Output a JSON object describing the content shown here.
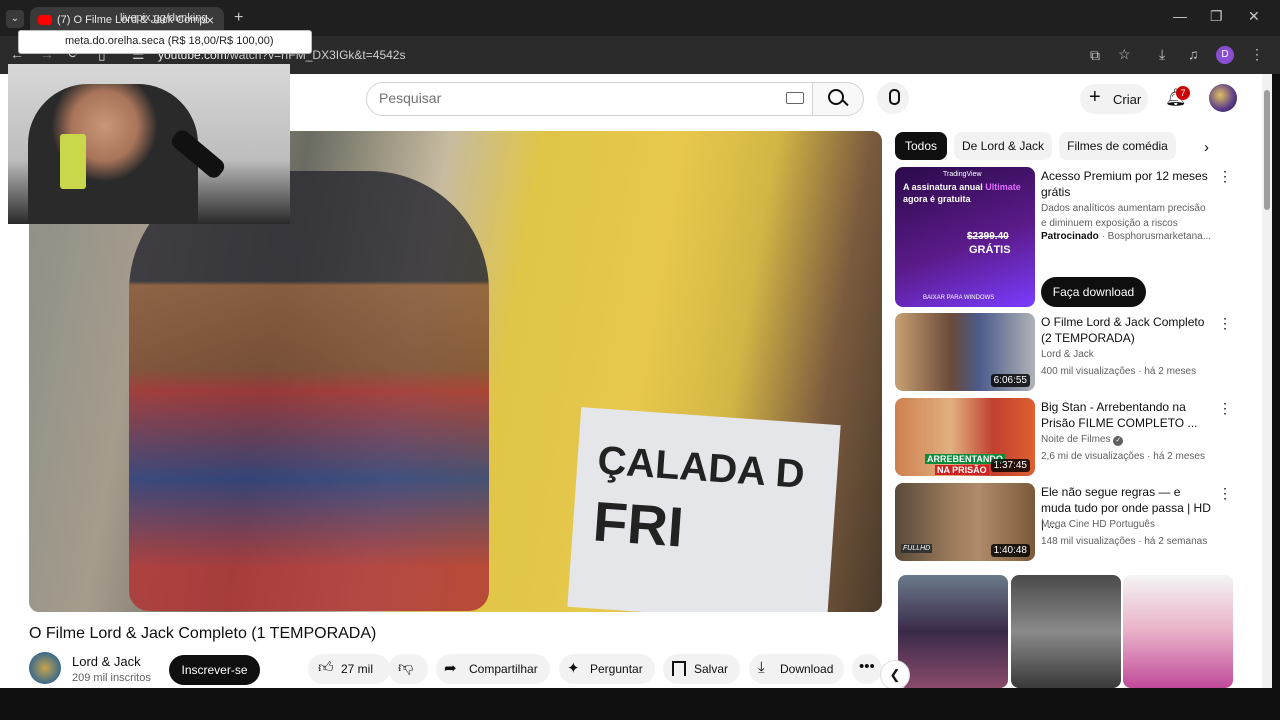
{
  "browser": {
    "tab_title": "(7) O Filme Lord & Jack Completo",
    "tab_overlay": "livepix.gg/dunking",
    "tab_close": "×",
    "new_tab": "+",
    "url_host": "youtube.com",
    "url_path": "/watch?v=rfFM_DX3IGk&t=4542s",
    "profile_initial": "D"
  },
  "tooltip": {
    "text": "meta.do.orelha.seca (R$ 18,00/R$ 100,00)"
  },
  "header": {
    "search_placeholder": "Pesquisar",
    "create_label": "Criar",
    "notifications_count": "7"
  },
  "video": {
    "title": "O Filme Lord & Jack Completo (1 TEMPORADA)",
    "sign_text_1": "ÇALADA D",
    "sign_text_2": "FRI",
    "channel_name": "Lord & Jack",
    "channel_subs": "209 mil inscritos",
    "subscribe_label": "Inscrever-se",
    "likes": "27 mil",
    "share_label": "Compartilhar",
    "ask_label": "Perguntar",
    "save_label": "Salvar",
    "download_label": "Download"
  },
  "chips": [
    "Todos",
    "De Lord & Jack",
    "Filmes de comédia"
  ],
  "ad": {
    "title": "Acesso Premium por 12 meses grátis",
    "desc": "Dados analíticos aumentam precisão e diminuem exposição a riscos",
    "sponsored": "Patrocinado",
    "advertiser": "· Bosphorusmarketana...",
    "cta": "Faça download",
    "thumb_brand": "TradingView",
    "thumb_line1": "A assinatura anual",
    "thumb_line1_accent": "Ultimate",
    "thumb_line2": "agora é gratuita",
    "thumb_price": "$2399.40",
    "thumb_free": "GRÁTIS",
    "thumb_footer": "BAIXAR PARA WINDOWS"
  },
  "related": [
    {
      "title": "O Filme Lord & Jack Completo (2 TEMPORADA)",
      "channel": "Lord & Jack",
      "meta": "400 mil visualizações · há 2 meses",
      "duration": "6:06:55"
    },
    {
      "title": "Big Stan - Arrebentando na Prisão FILME COMPLETO ...",
      "channel": "Noite de Filmes",
      "meta": "2,6 mi de visualizações · há 2 meses",
      "duration": "1:37:45",
      "thumb_text_1": "ARREBENTANDO",
      "thumb_text_2": "NA PRISÃO"
    },
    {
      "title": "Ele não segue regras — e muda tudo por onde passa | HD | ...",
      "channel": "Mega Cine HD Português",
      "meta": "148 mil visualizações · há 2 semanas",
      "duration": "1:40:48",
      "thumb_badge": "FULLHD"
    }
  ],
  "colors": {
    "accent_red": "#cc0000",
    "tradingview_purple": "#7a3cff"
  }
}
